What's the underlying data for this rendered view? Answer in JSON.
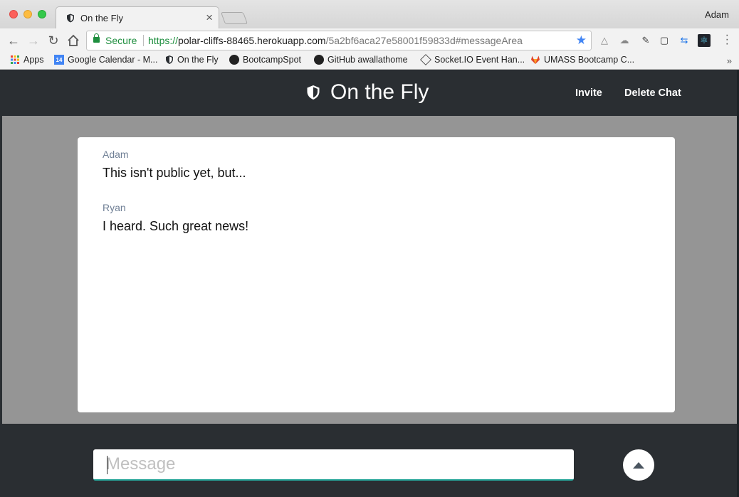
{
  "browser": {
    "tab_title": "On the Fly",
    "tab_close": "×",
    "profile_name": "Adam",
    "secure_label": "Secure",
    "url_protocol": "https://",
    "url_host": "polar-cliffs-88465.herokuapp.com",
    "url_path": "/5a2bf6aca27e58001f59833d#messageArea",
    "bookmarks": [
      {
        "label": "Apps",
        "icon": "apps-grid-icon"
      },
      {
        "label": "Google Calendar - M...",
        "icon": "calendar-icon"
      },
      {
        "label": "On the Fly",
        "icon": "shield-icon"
      },
      {
        "label": "BootcampSpot",
        "icon": "github-icon"
      },
      {
        "label": "GitHub awallathome",
        "icon": "github-icon"
      },
      {
        "label": "Socket.IO Event Han...",
        "icon": "socketio-icon"
      },
      {
        "label": "UMASS Bootcamp C...",
        "icon": "gitlab-icon"
      }
    ],
    "more_bookmarks": "»",
    "calendar_day": "14"
  },
  "header": {
    "title": "On the Fly",
    "invite_label": "Invite",
    "delete_label": "Delete Chat"
  },
  "messages": [
    {
      "author": "Adam",
      "text": "This isn't public yet, but..."
    },
    {
      "author": "Ryan",
      "text": "I heard. Such great news!"
    }
  ],
  "composer": {
    "placeholder": "Message"
  },
  "colors": {
    "app_bg": "#2a2e32",
    "chat_bg": "#959595",
    "author": "#6f7f95",
    "accent": "#26a69a"
  }
}
